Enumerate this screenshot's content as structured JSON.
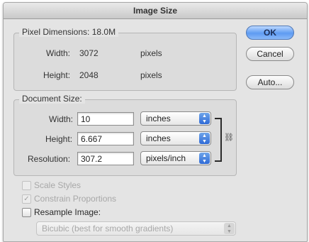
{
  "window": {
    "title": "Image Size"
  },
  "buttons": {
    "ok": "OK",
    "cancel": "Cancel",
    "auto": "Auto..."
  },
  "pixel_dimensions": {
    "legend": "Pixel Dimensions:",
    "size": "18.0M",
    "width_label": "Width:",
    "width_value": "3072",
    "width_unit": "pixels",
    "height_label": "Height:",
    "height_value": "2048",
    "height_unit": "pixels"
  },
  "document_size": {
    "legend": "Document Size:",
    "width_label": "Width:",
    "width_value": "10",
    "width_unit": "inches",
    "height_label": "Height:",
    "height_value": "6.667",
    "height_unit": "inches",
    "resolution_label": "Resolution:",
    "resolution_value": "307.2",
    "resolution_unit": "pixels/inch"
  },
  "options": {
    "scale_styles": {
      "label": "Scale Styles",
      "checked": false,
      "enabled": false
    },
    "constrain_proportions": {
      "label": "Constrain Proportions",
      "checked": true,
      "enabled": false
    },
    "resample_image": {
      "label": "Resample Image:",
      "checked": false,
      "enabled": true
    },
    "resample_method": {
      "value": "Bicubic (best for smooth gradients)",
      "enabled": false
    }
  },
  "icons": {
    "select_arrows": "up-down-arrows-icon",
    "link": "chain-link-icon",
    "checkmark": "checkmark-icon"
  }
}
